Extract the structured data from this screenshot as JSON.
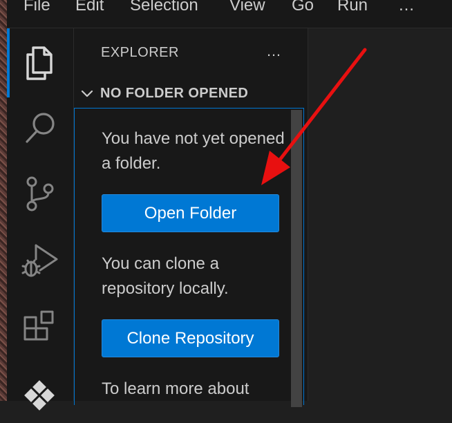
{
  "menubar": {
    "items": [
      "File",
      "Edit",
      "Selection",
      "View",
      "Go",
      "Run"
    ],
    "more": "…"
  },
  "activity_bar": {
    "icons": [
      "files-icon",
      "search-icon",
      "source-control-icon",
      "run-debug-icon",
      "extensions-icon",
      "remote-icon"
    ]
  },
  "sidebar": {
    "title": "EXPLORER",
    "more": "…",
    "section_title": "NO FOLDER OPENED",
    "message1": "You have not yet opened a folder.",
    "open_folder_label": "Open Folder",
    "message2": "You can clone a repository locally.",
    "clone_label": "Clone Repository",
    "message3": "To learn more about"
  },
  "colors": {
    "accent": "#0078d4",
    "annotation_arrow": "#e81010"
  }
}
